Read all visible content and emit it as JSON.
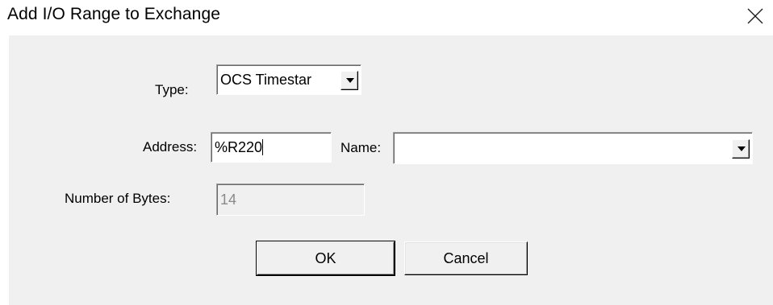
{
  "window": {
    "title": "Add I/O Range to Exchange"
  },
  "form": {
    "type_label": "Type:",
    "type_value": "OCS Timestar",
    "address_label": "Address:",
    "address_value": "%R220",
    "name_label": "Name:",
    "name_value": "",
    "bytes_label": "Number of Bytes:",
    "bytes_value": "14"
  },
  "buttons": {
    "ok_label": "OK",
    "cancel_label": "Cancel"
  },
  "icons": {
    "close": "close-icon",
    "dropdown": "chevron-down-icon"
  },
  "colors": {
    "dialog_bg": "#f0f0f0",
    "disabled_text": "#8a8a8a"
  }
}
